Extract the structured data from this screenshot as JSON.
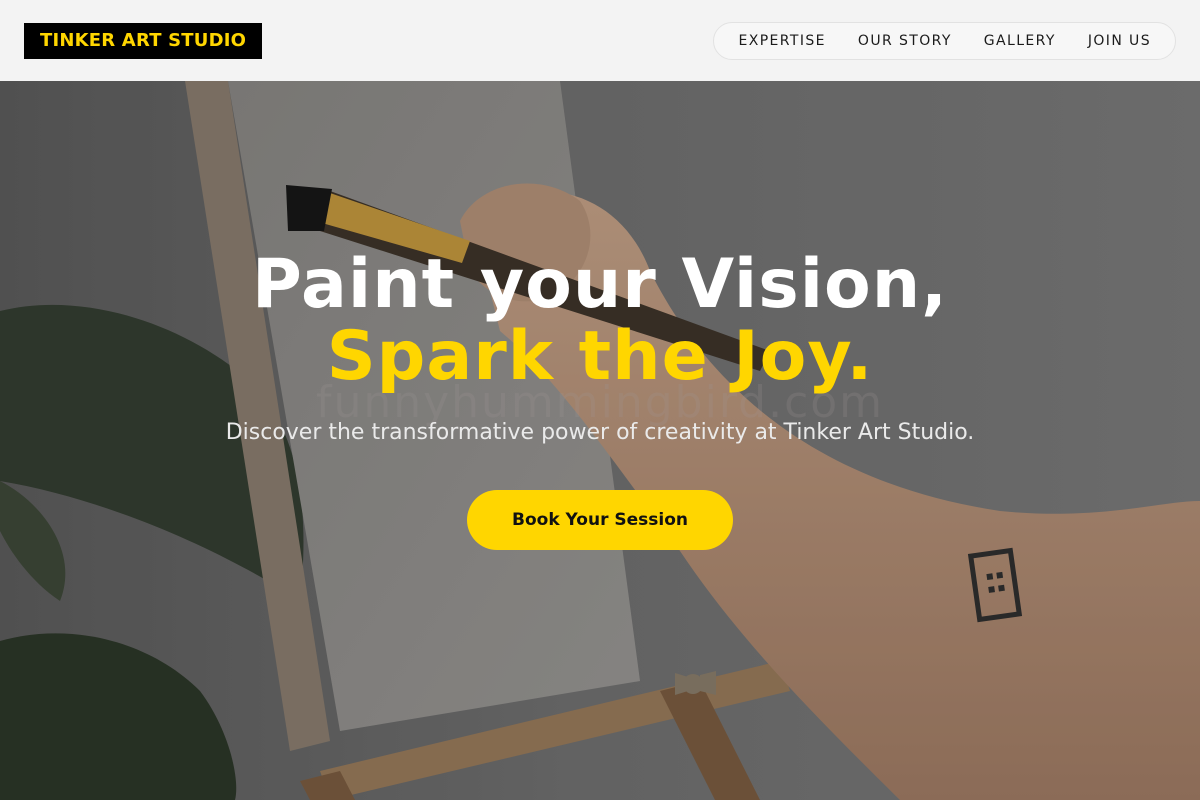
{
  "header": {
    "logo_text": "TINKER ART STUDIO",
    "nav": [
      {
        "label": "EXPERTISE"
      },
      {
        "label": "OUR STORY"
      },
      {
        "label": "GALLERY"
      },
      {
        "label": "JOIN US"
      }
    ]
  },
  "hero": {
    "headline_line1": "Paint your Vision,",
    "headline_line2": "Spark the Joy.",
    "watermark": "funnyhummingbird.com",
    "subtitle": "Discover the transformative power of creativity at Tinker Art Studio.",
    "cta_label": "Book Your Session"
  },
  "colors": {
    "accent": "#ffd600",
    "logo_bg": "#000000",
    "header_bg": "#f3f3f3"
  }
}
